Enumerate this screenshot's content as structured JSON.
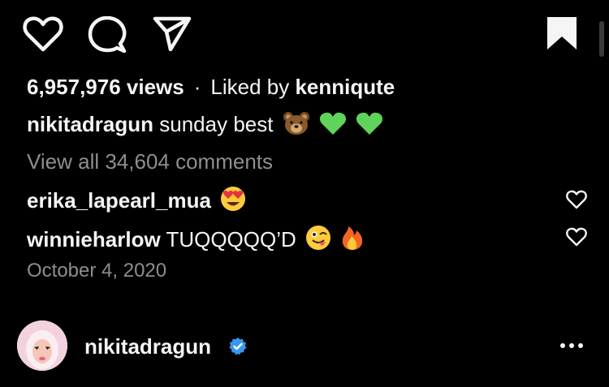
{
  "post": {
    "views": "6,957,976 views",
    "separator": "·",
    "liked_by_prefix": "Liked by",
    "liked_by_user": "kenniqute",
    "caption_user": "nikitadragun",
    "caption_text": "sunday best",
    "caption_emojis": [
      "bear-emoji",
      "green-heart-emoji",
      "green-heart-emoji"
    ],
    "view_all_comments": "View all 34,604 comments",
    "comments": [
      {
        "user": "erika_lapearl_mua",
        "text": "",
        "emojis": [
          "heart-eyes-emoji"
        ]
      },
      {
        "user": "winnieharlow",
        "text": "TUQQQQQ’D",
        "emojis": [
          "winking-tongue-emoji",
          "fire-emoji"
        ]
      }
    ],
    "date": "October 4, 2020"
  },
  "actions": {
    "icons": [
      "heart-icon",
      "comment-icon",
      "share-icon",
      "bookmark-icon"
    ]
  },
  "footer": {
    "username": "nikitadragun",
    "verified": true,
    "more_icon": "more-options-icon"
  },
  "colors": {
    "background": "#000000",
    "text": "#f5f5f5",
    "muted": "#8e8e8e",
    "verified_blue": "#3897f0"
  }
}
